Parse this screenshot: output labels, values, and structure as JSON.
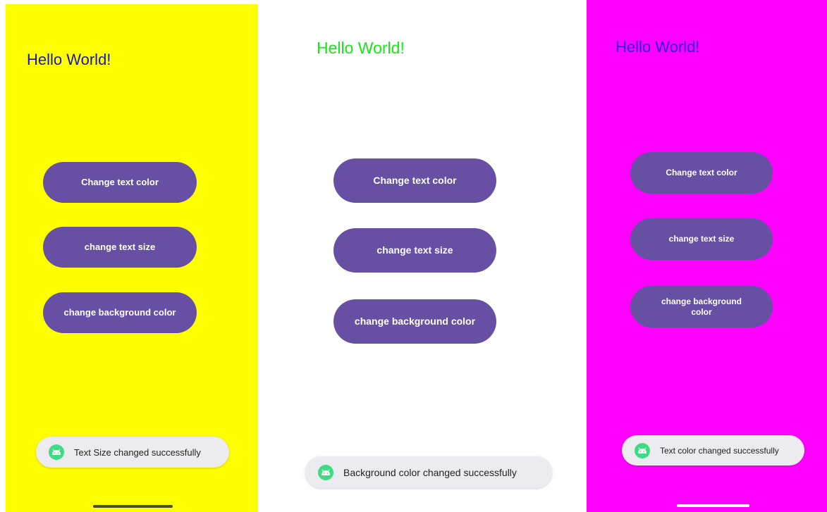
{
  "screens": [
    {
      "background": "#ffff00",
      "title": "Hello World!",
      "title_color": "#1a18b0",
      "buttons": {
        "text_color": "Change text color",
        "text_size": "change text size",
        "background_color": "change background color"
      },
      "toast": "Text Size changed successfully",
      "nav_handle_color": "#4a4a2a"
    },
    {
      "background": "#ffffff",
      "title": "Hello World!",
      "title_color": "#19e61a",
      "buttons": {
        "text_color": "Change text color",
        "text_size": "change text size",
        "background_color": "change background color"
      },
      "toast": "Background color changed successfully"
    },
    {
      "background": "#ff00ff",
      "title": "Hello World!",
      "title_color": "#2b16e8",
      "buttons": {
        "text_color": "Change text color",
        "text_size": "change text size",
        "background_color": "change background color"
      },
      "toast": "Text color changed successfully",
      "nav_handle_color": "#ffffff"
    }
  ],
  "colors": {
    "button_fill": "#6750a4",
    "button_text": "#ffffff",
    "toast_fill": "#ececf0",
    "toast_icon": "#3ddc84"
  },
  "icons": {
    "toast_icon": "android-icon"
  }
}
